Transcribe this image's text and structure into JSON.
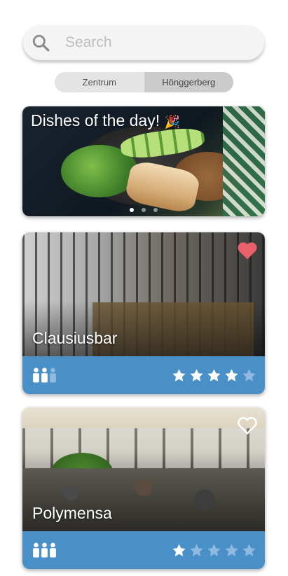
{
  "search": {
    "placeholder": "Search",
    "value": ""
  },
  "campus_toggle": {
    "options": [
      "Zentrum",
      "Hönggerberg"
    ],
    "selected": "Hönggerberg"
  },
  "dishes_card": {
    "title": "Dishes of the day!",
    "carousel_pages": 3,
    "active_page": 1
  },
  "cafeterias": [
    {
      "name": "Clausiusbar",
      "favorite": true,
      "occupancy_level": 2.5,
      "occupancy_max": 3,
      "rating": 4,
      "rating_max": 5
    },
    {
      "name": "Polymensa",
      "favorite": false,
      "occupancy_level": 3,
      "occupancy_max": 3,
      "rating": 1,
      "rating_max": 5
    }
  ],
  "colors": {
    "accent": "#4a90c8",
    "heart_active": "#e8606a",
    "star_active": "#ffffff",
    "star_inactive": "#8fb9de"
  },
  "icons": {
    "search": "search-icon",
    "favorite": "heart-icon",
    "occupancy": "person-icon",
    "rating": "star-icon",
    "celebration": "party-popper-icon"
  }
}
